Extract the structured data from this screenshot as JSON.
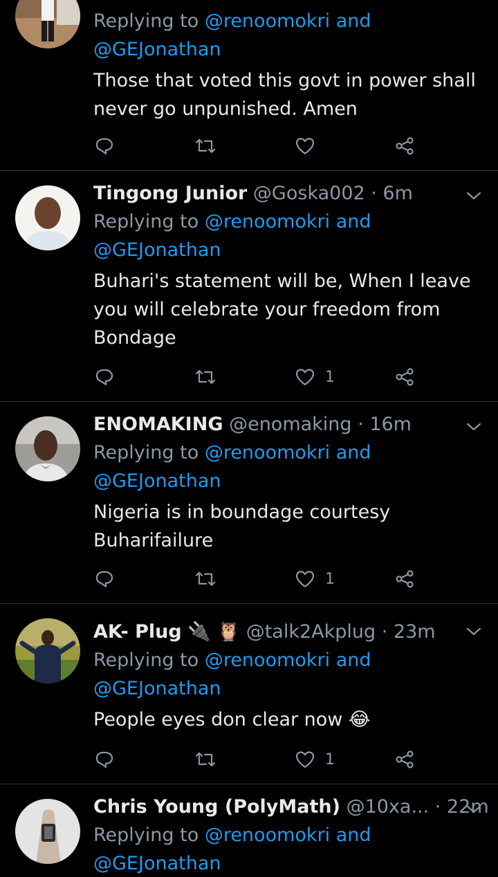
{
  "tweets": [
    {
      "name": "",
      "handle": "",
      "time": "",
      "reply_prefix": "Replying to",
      "reply_to_1": "@renoomokri and",
      "reply_to_2": "@GEJonathan",
      "text": "Those that voted this govt in power shall never go unpunished. Amen",
      "like_count": "",
      "avatar": "person-standing-white-shirt"
    },
    {
      "name": "Tingong Junior",
      "handle": "@Goska002",
      "time": "· 6m",
      "reply_prefix": "Replying to",
      "reply_to_1": "@renoomokri and",
      "reply_to_2": "@GEJonathan",
      "text": "Buhari's statement will be, When I leave you will celebrate your freedom from Bondage",
      "like_count": "1",
      "avatar": "man-portrait-white-shirt"
    },
    {
      "name": "ENOMAKING",
      "handle": "@enomaking",
      "time": "· 16m",
      "reply_prefix": "Replying to",
      "reply_to_1": "@renoomokri and",
      "reply_to_2": "@GEJonathan",
      "text": "Nigeria is in boundage courtesy Buharifailure",
      "like_count": "1",
      "avatar": "man-portrait-bowtie"
    },
    {
      "name": "AK- Plug",
      "name_emoji": "🔌 🦉",
      "handle": "@talk2Akplug",
      "time": "· 23m",
      "reply_prefix": "Replying to",
      "reply_to_1": "@renoomokri and",
      "reply_to_2": "@GEJonathan",
      "text": "People eyes don clear now",
      "text_emoji": "😂",
      "like_count": "1",
      "avatar": "man-suit-outdoors"
    },
    {
      "name": "Chris Young (PolyMath)",
      "handle": "@10xa...",
      "time": "· 22m",
      "reply_prefix": "Replying to",
      "reply_to_1": "@renoomokri and",
      "reply_to_2": "@GEJonathan",
      "text": "",
      "like_count": "",
      "avatar": "tattoo-arm"
    }
  ],
  "colors": {
    "background": "#000000",
    "text": "#e7e9ea",
    "muted": "#8b98a5",
    "link": "#1d9bf0",
    "divider": "#2f3336"
  },
  "icons": [
    "reply-icon",
    "retweet-icon",
    "like-icon",
    "share-icon",
    "chevron-down-icon"
  ]
}
